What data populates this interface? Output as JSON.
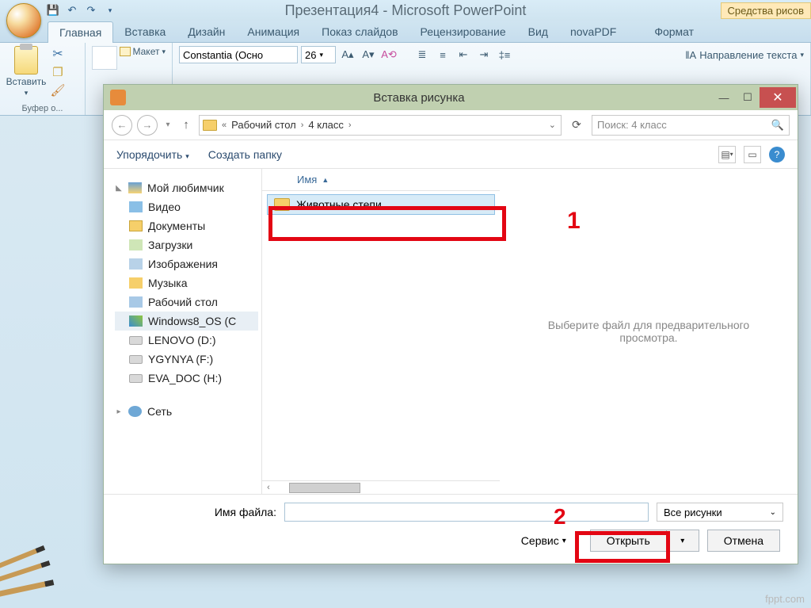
{
  "app": {
    "title": "Презентация4 - Microsoft PowerPoint",
    "drawing_tools": "Средства рисов"
  },
  "tabs": {
    "home": "Главная",
    "insert": "Вставка",
    "design": "Дизайн",
    "animation": "Анимация",
    "slideshow": "Показ слайдов",
    "review": "Рецензирование",
    "view": "Вид",
    "novapdf": "novaPDF",
    "format": "Формат"
  },
  "ribbon": {
    "paste": "Вставить",
    "clipboard": "Буфер о...",
    "layout": "Макет",
    "font": "Constantia (Осно",
    "font_size": "26",
    "text_direction": "Направление текста"
  },
  "dialog": {
    "title": "Вставка рисунка",
    "breadcrumbs": {
      "root_chevrons": "«",
      "desktop": "Рабочий стол",
      "klass": "4 класс"
    },
    "search_placeholder": "Поиск: 4 класс",
    "organize": "Упорядочить",
    "new_folder": "Создать папку",
    "col_name": "Имя",
    "tree": {
      "favorites": "Мой любимчик",
      "video": "Видео",
      "documents": "Документы",
      "downloads": "Загрузки",
      "pictures": "Изображения",
      "music": "Музыка",
      "desktop": "Рабочий стол",
      "os": "Windows8_OS (C",
      "lenovo": "LENOVO (D:)",
      "ygynya": "YGYNYA (F:)",
      "eva": "EVA_DOC (H:)",
      "network": "Сеть"
    },
    "files": {
      "item1": "Животные степи"
    },
    "preview_hint": "Выберите файл для предварительного просмотра.",
    "filename_label": "Имя файла:",
    "filetype": "Все рисунки",
    "service": "Сервис",
    "open": "Открыть",
    "cancel": "Отмена"
  },
  "annotations": {
    "one": "1",
    "two": "2"
  },
  "watermark": "fppt.com"
}
